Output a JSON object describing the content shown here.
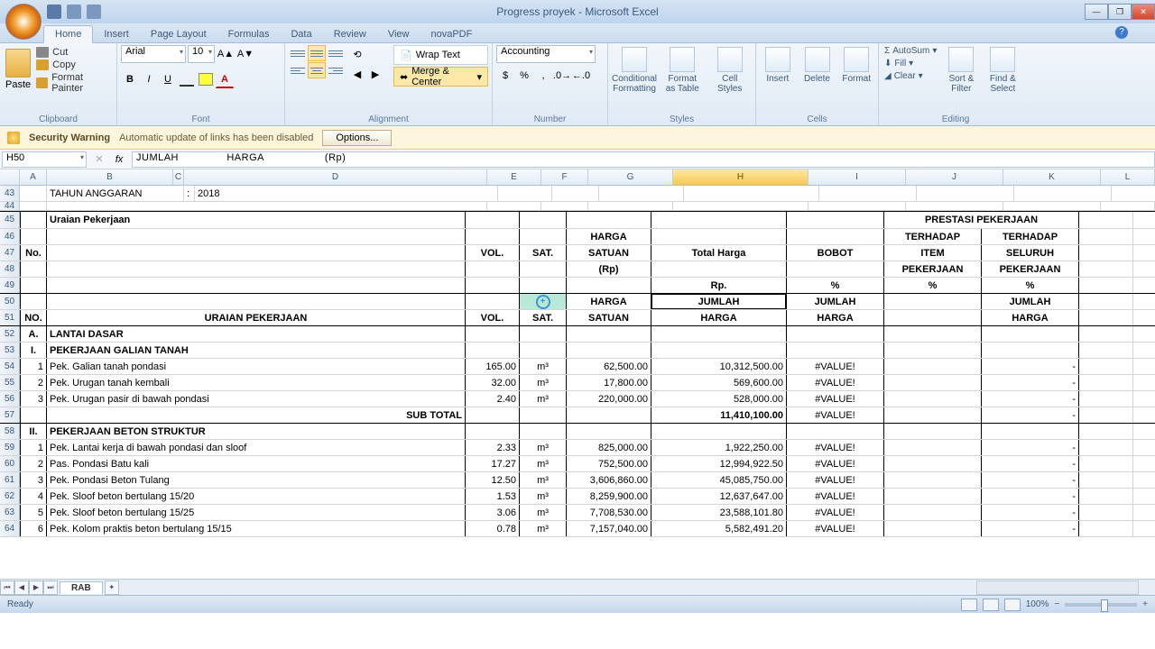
{
  "app": {
    "title": "Progress proyek - Microsoft Excel"
  },
  "tabs": [
    "Home",
    "Insert",
    "Page Layout",
    "Formulas",
    "Data",
    "Review",
    "View",
    "novaPDF"
  ],
  "active_tab": "Home",
  "ribbon": {
    "clipboard": {
      "paste": "Paste",
      "cut": "Cut",
      "copy": "Copy",
      "painter": "Format Painter",
      "label": "Clipboard"
    },
    "font": {
      "name": "Arial",
      "size": "10",
      "label": "Font"
    },
    "alignment": {
      "wrap": "Wrap Text",
      "merge": "Merge & Center",
      "label": "Alignment"
    },
    "number": {
      "format": "Accounting",
      "label": "Number"
    },
    "styles": {
      "cond": "Conditional Formatting",
      "table": "Format as Table",
      "cell": "Cell Styles",
      "label": "Styles"
    },
    "cells": {
      "insert": "Insert",
      "delete": "Delete",
      "format": "Format",
      "label": "Cells"
    },
    "editing": {
      "sum": "AutoSum",
      "fill": "Fill",
      "clear": "Clear",
      "sort": "Sort & Filter",
      "find": "Find & Select",
      "label": "Editing"
    }
  },
  "security": {
    "title": "Security Warning",
    "msg": "Automatic update of links has been disabled",
    "btn": "Options..."
  },
  "namebox": "H50",
  "formula": "JUMLAH               HARGA                   (Rp)",
  "col_letters": [
    "A",
    "B",
    "C",
    "D",
    "E",
    "F",
    "G",
    "H",
    "I",
    "J",
    "K",
    "L"
  ],
  "rows_visible": [
    43,
    44,
    45,
    46,
    47,
    48,
    49,
    50,
    51,
    52,
    53,
    54,
    55,
    56,
    57,
    58,
    59,
    60,
    61,
    62,
    63,
    64
  ],
  "row43": {
    "b": "TAHUN ANGGARAN",
    "c": ":",
    "d": "2018"
  },
  "headers": {
    "no": "No.",
    "uraian": "Uraian Pekerjaan",
    "vol": "VOL.",
    "sat": "SAT.",
    "harga_satuan": "HARGA SATUAN (Rp)",
    "total": "Total Harga",
    "rp": "Rp.",
    "bobot": "BOBOT",
    "pct": "%",
    "prestasi": "PRESTASI PEKERJAAN",
    "terhadap_item": "TERHADAP ITEM PEKERJAAN %",
    "terhadap_seluruh": "TERHADAP SELURUH PEKERJAAN %",
    "no2": "NO.",
    "uraian2": "URAIAN PEKERJAAN",
    "jumlah_harga": "JUMLAH HARGA (Rp)"
  },
  "sections": {
    "A": {
      "code": "A.",
      "title": "LANTAI DASAR"
    },
    "I": {
      "code": "I.",
      "title": "PEKERJAAN GALIAN TANAH"
    },
    "II": {
      "code": "II.",
      "title": "PEKERJAAN BETON STRUKTUR"
    },
    "subtotal_label": "SUB TOTAL"
  },
  "items": [
    {
      "n": "1",
      "desc": "Pek. Galian tanah pondasi",
      "vol": "165.00",
      "sat": "m³",
      "hs": "62,500.00",
      "tot": "10,312,500.00"
    },
    {
      "n": "2",
      "desc": "Pek. Urugan tanah kembali",
      "vol": "32.00",
      "sat": "m³",
      "hs": "17,800.00",
      "tot": "569,600.00"
    },
    {
      "n": "3",
      "desc": "Pek. Urugan pasir di bawah pondasi",
      "vol": "2.40",
      "sat": "m³",
      "hs": "220,000.00",
      "tot": "528,000.00"
    }
  ],
  "subtotal": "11,410,100.00",
  "items2": [
    {
      "n": "1",
      "desc": "Pek. Lantai kerja di bawah pondasi dan sloof",
      "vol": "2.33",
      "sat": "m³",
      "hs": "825,000.00",
      "tot": "1,922,250.00"
    },
    {
      "n": "2",
      "desc": "Pas. Pondasi Batu kali",
      "vol": "17.27",
      "sat": "m³",
      "hs": "752,500.00",
      "tot": "12,994,922.50"
    },
    {
      "n": "3",
      "desc": "Pek. Pondasi Beton Tulang",
      "vol": "12.50",
      "sat": "m³",
      "hs": "3,606,860.00",
      "tot": "45,085,750.00"
    },
    {
      "n": "4",
      "desc": "Pek. Sloof beton bertulang 15/20",
      "vol": "1.53",
      "sat": "m³",
      "hs": "8,259,900.00",
      "tot": "12,637,647.00"
    },
    {
      "n": "5",
      "desc": "Pek. Sloof beton bertulang 15/25",
      "vol": "3.06",
      "sat": "m³",
      "hs": "7,708,530.00",
      "tot": "23,588,101.80"
    },
    {
      "n": "6",
      "desc": "Pek. Kolom praktis beton bertulang 15/15",
      "vol": "0.78",
      "sat": "m³",
      "hs": "7,157,040.00",
      "tot": "5,582,491.20"
    }
  ],
  "value_err": "#VALUE!",
  "dash": "-",
  "sheet": "RAB",
  "status": "Ready",
  "zoom": "100%"
}
